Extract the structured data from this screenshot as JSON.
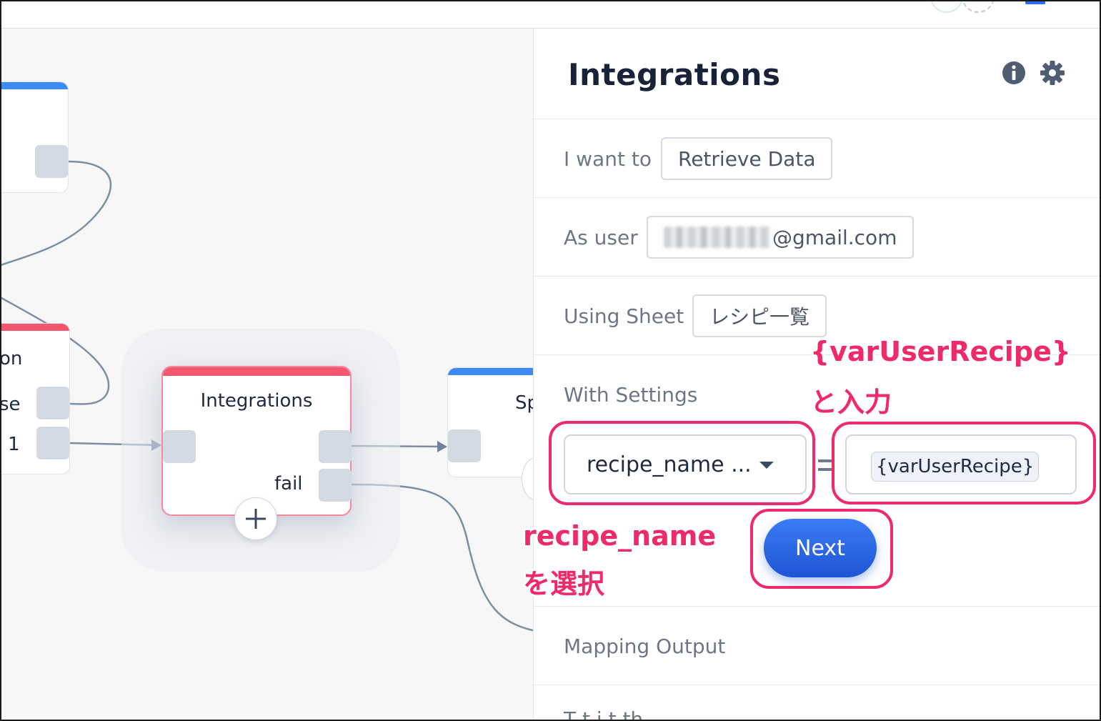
{
  "canvas": {
    "node_left_top": {},
    "node_left_bottom": {
      "label_partial": "on",
      "output_labels": [
        "se",
        "1"
      ]
    },
    "node_main": {
      "title": "Integrations",
      "fail_label": "fail",
      "add_icon": "plus-icon"
    },
    "node_right": {
      "title_partial": "Sp"
    }
  },
  "panel": {
    "title": "Integrations",
    "header_icons": [
      "info-icon",
      "gear-icon"
    ],
    "rows": {
      "action": {
        "label": "I want to",
        "value": "Retrieve Data"
      },
      "user": {
        "label": "As user",
        "value_suffix": "@gmail.com"
      },
      "sheet": {
        "label": "Using Sheet",
        "value": "レシピ一覧"
      },
      "settings": {
        "label": "With Settings",
        "field_selected": "recipe_name ...",
        "value": "{varUserRecipe}"
      }
    },
    "next_label": "Next",
    "mapping_label": "Mapping Output",
    "last_label_partial": "T    t i   t    th"
  },
  "annotations": {
    "value_note_line1": "{varUserRecipe}",
    "value_note_line2": "と入力",
    "select_note_line1": "recipe_name",
    "select_note_line2": "を選択"
  },
  "colors": {
    "accent_blue": "#2c6df2",
    "node_red": "#f2576f",
    "node_blue": "#3d8af7",
    "annotation_pink": "#ee2b68"
  }
}
